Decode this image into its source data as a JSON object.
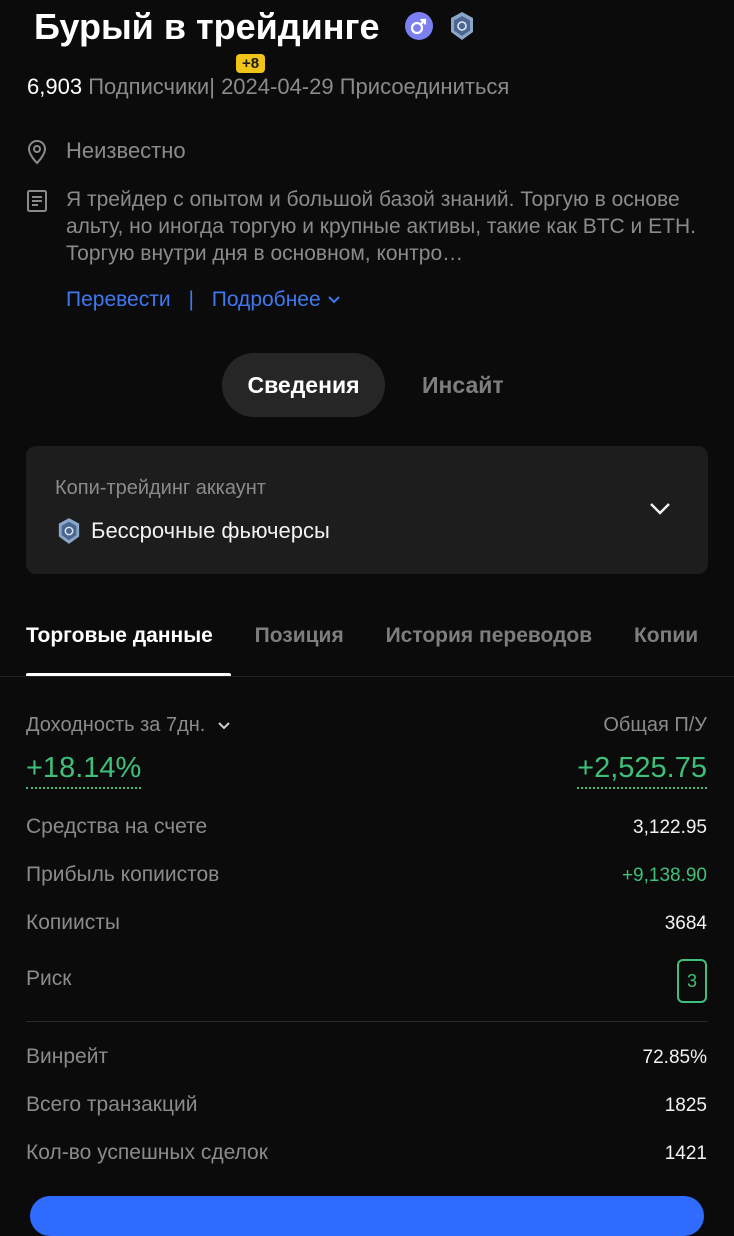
{
  "profile": {
    "name": "Бурый в трейдинге",
    "followers_count": "6,903",
    "followers_label": "Подписчики",
    "followers_delta": "+8",
    "divider": "|",
    "join_date": "2024-04-29",
    "join_label": "Присоединиться",
    "location": "Неизвестно",
    "bio": "Я трейдер с опытом и большой базой знаний. Торгую в основе альту, но иногда торгую и крупные активы, такие как BTC и ETH. Торгую внутри дня в основном, контро…",
    "translate_link": "Перевести",
    "links_sep": "|",
    "more_link": "Подробнее"
  },
  "main_tabs": [
    {
      "label": "Сведения",
      "active": true
    },
    {
      "label": "Инсайт",
      "active": false
    }
  ],
  "account_card": {
    "label": "Копи-трейдинг аккаунт",
    "value": "Бессрочные фьючерсы"
  },
  "sub_tabs": [
    {
      "label": "Торговые данные",
      "active": true
    },
    {
      "label": "Позиция",
      "active": false
    },
    {
      "label": "История переводов",
      "active": false
    },
    {
      "label": "Копии",
      "active": false
    }
  ],
  "summary": {
    "yield_label": "Доходность за 7дн.",
    "yield_value": "+18.14%",
    "pnl_label": "Общая П/У",
    "pnl_value": "+2,525.75"
  },
  "stats": [
    {
      "label": "Средства на счете",
      "value": "3,122.95"
    },
    {
      "label": "Прибыль копиистов",
      "value": "+9,138.90"
    },
    {
      "label": "Копиисты",
      "value": "3684"
    },
    {
      "label": "Риск",
      "value": "3"
    },
    {
      "label": "Винрейт",
      "value": "72.85%"
    },
    {
      "label": "Всего транзакций",
      "value": "1825"
    },
    {
      "label": "Кол-во успешных сделок",
      "value": "1421"
    }
  ],
  "colors": {
    "background": "#0b0b0b",
    "positive": "#3fc07a",
    "link": "#3f78f0",
    "badge": "#f0c419"
  },
  "icons": [
    "male-icon",
    "shield-badge-icon",
    "location-pin-icon",
    "document-icon",
    "chevron-down-icon"
  ]
}
